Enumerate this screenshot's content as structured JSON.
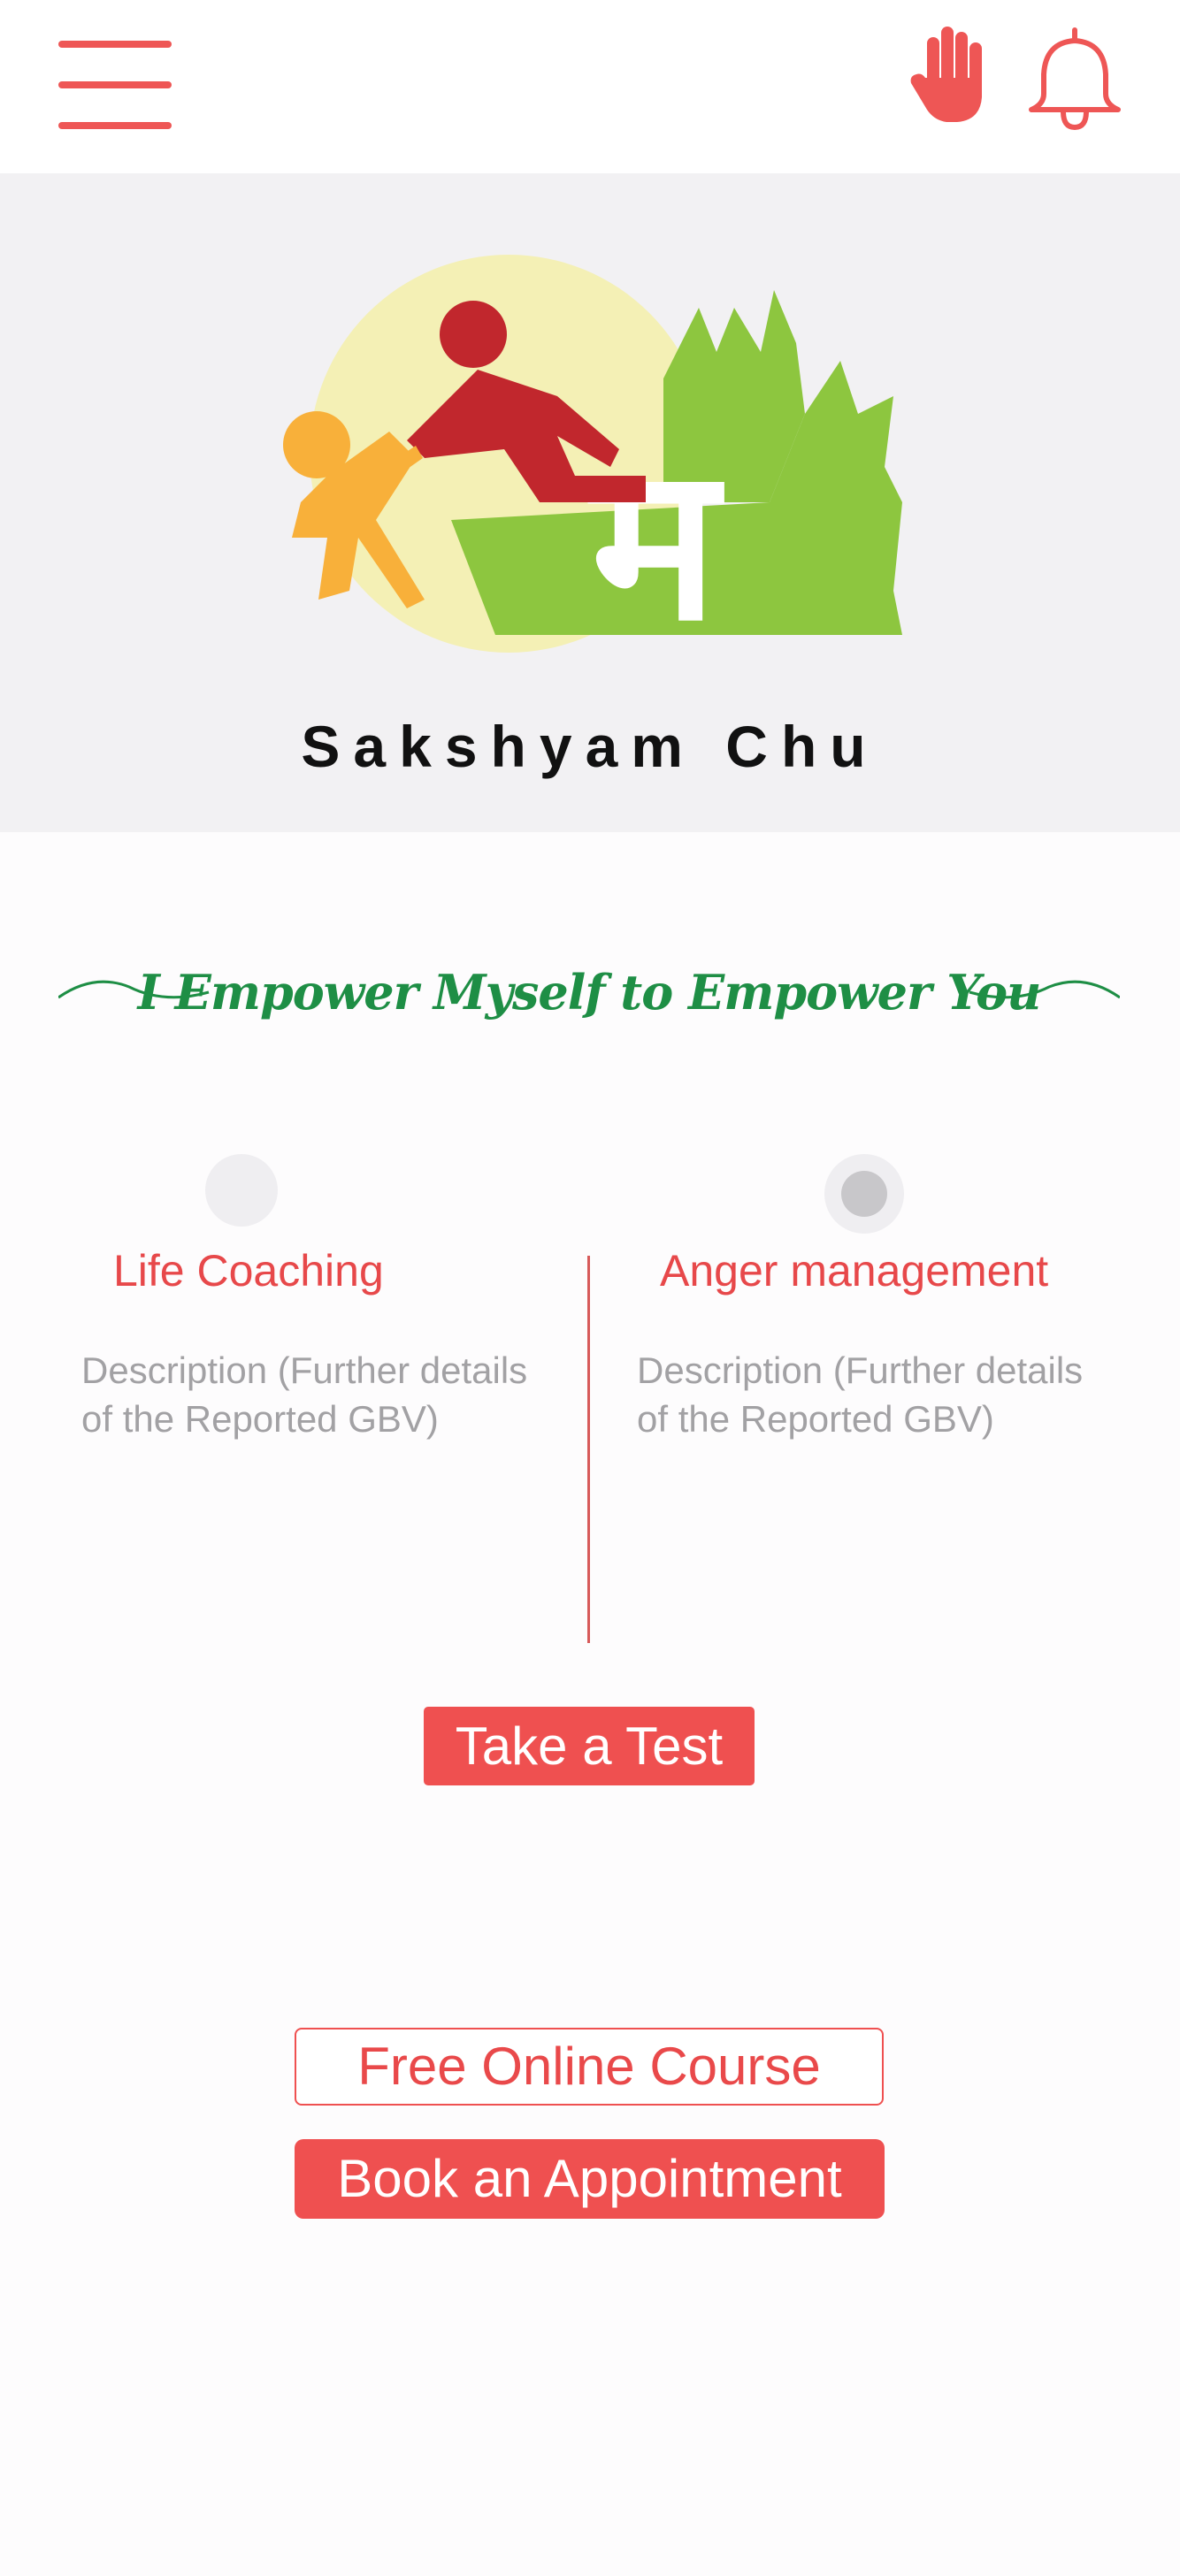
{
  "header": {
    "menu_icon": "hamburger-menu-icon",
    "hand_icon": "hand-stop-icon",
    "bell_icon": "notification-bell-icon",
    "accent_color": "#ee5655"
  },
  "banner": {
    "logo_glyph": "म",
    "logo_text": "Sakshyam Chu",
    "background_color": "#f2f1f3"
  },
  "tagline": {
    "text": "I Empower Myself to Empower You",
    "color": "#1e8e45"
  },
  "services": [
    {
      "title": "Life Coaching",
      "description": "Description (Further details of the Reported GBV)",
      "selected": false
    },
    {
      "title": "Anger management",
      "description": "Description (Further details of the Reported GBV)",
      "selected": true
    }
  ],
  "actions": {
    "take_test": "Take a Test",
    "free_course": "Free Online Course",
    "book_appointment": "Book an Appointment"
  }
}
